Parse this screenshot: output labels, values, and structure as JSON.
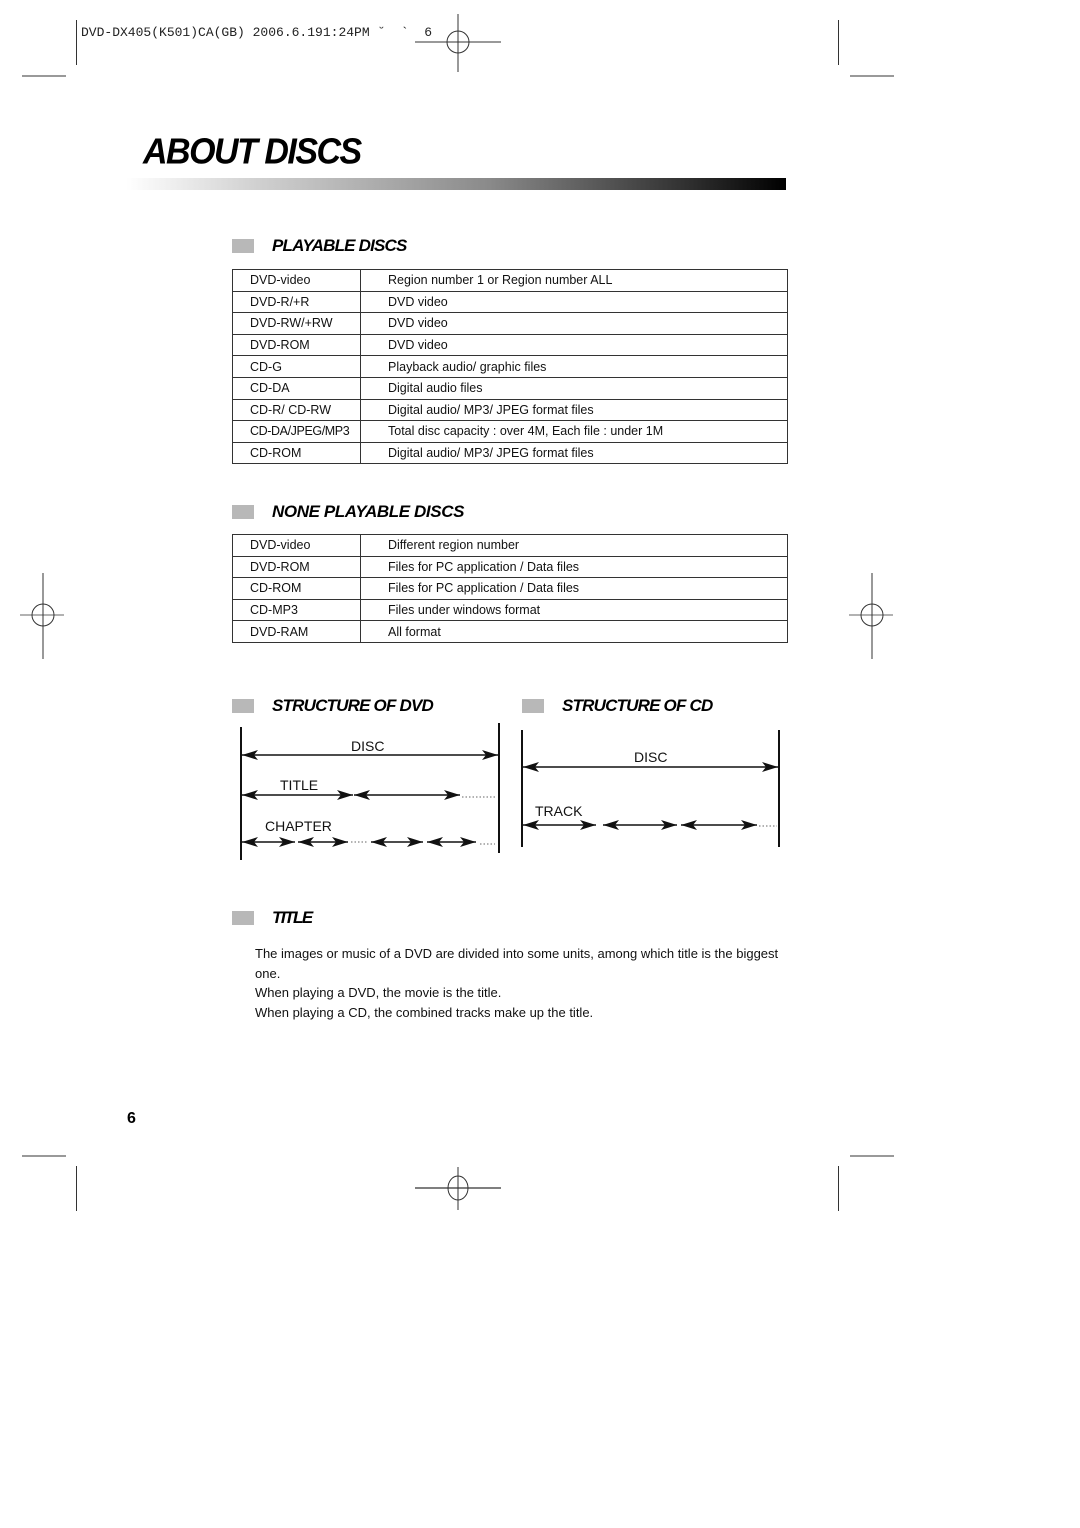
{
  "header": {
    "slug": "DVD-DX405(K501)CA(GB) 2006.6.191:24PM ˘  `  6"
  },
  "page": {
    "title": "ABOUT DISCS",
    "number": "6"
  },
  "playable": {
    "heading": "PLAYABLE DISCS",
    "rows": [
      {
        "disc": "DVD-video",
        "info": "Region number 1 or Region number ALL"
      },
      {
        "disc": "DVD-R/+R",
        "info": "DVD video"
      },
      {
        "disc": "DVD-RW/+RW",
        "info": "DVD video"
      },
      {
        "disc": "DVD-ROM",
        "info": "DVD video"
      },
      {
        "disc": "CD-G",
        "info": "Playback audio/ graphic files"
      },
      {
        "disc": "CD-DA",
        "info": "Digital audio files"
      },
      {
        "disc": "CD-R/ CD-RW",
        "info": "Digital audio/ MP3/ JPEG format files"
      },
      {
        "disc": "CD-DA/JPEG/MP3",
        "info": "Total disc capacity : over 4M, Each file : under 1M"
      },
      {
        "disc": "CD-ROM",
        "info": "Digital audio/ MP3/ JPEG format files"
      }
    ]
  },
  "non_playable": {
    "heading": "NONE PLAYABLE DISCS",
    "rows": [
      {
        "disc": "DVD-video",
        "info": "Different region number"
      },
      {
        "disc": "DVD-ROM",
        "info": "Files for PC application / Data files"
      },
      {
        "disc": "CD-ROM",
        "info": "Files for PC application / Data files"
      },
      {
        "disc": "CD-MP3",
        "info": "Files under windows format"
      },
      {
        "disc": "DVD-RAM",
        "info": "All format"
      }
    ]
  },
  "structure_dvd": {
    "heading": "STRUCTURE OF DVD",
    "labels": {
      "disc": "DISC",
      "title": "TITLE",
      "chapter": "CHAPTER"
    }
  },
  "structure_cd": {
    "heading": "STRUCTURE OF CD",
    "labels": {
      "disc": "DISC",
      "track": "TRACK"
    }
  },
  "title_section": {
    "heading": "TITLE",
    "paragraphs": [
      "The images or music of a DVD are divided into some units, among which title is the biggest one.",
      "When playing a DVD, the movie is the title.",
      "When playing a CD, the combined tracks make up the title."
    ]
  }
}
